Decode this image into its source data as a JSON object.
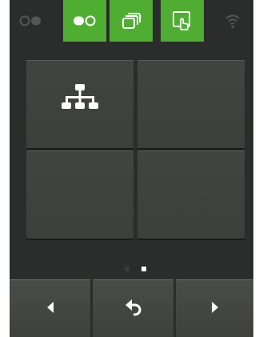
{
  "topbar": {
    "items": [
      {
        "name": "record-icon",
        "state": "disabled"
      },
      {
        "name": "tape-icon",
        "state": "active"
      },
      {
        "name": "stacked-windows-icon",
        "state": "active"
      },
      {
        "name": "touch-screen-icon",
        "state": "active"
      },
      {
        "name": "wifi-icon",
        "state": "disabled"
      }
    ]
  },
  "grid": {
    "tiles": [
      {
        "icon": "network-hierarchy-icon"
      },
      {
        "icon": ""
      },
      {
        "icon": ""
      },
      {
        "icon": ""
      }
    ]
  },
  "pagination": {
    "pages": 2,
    "current": 2
  },
  "bottombar": {
    "buttons": [
      {
        "icon": "arrow-left-icon"
      },
      {
        "icon": "undo-back-icon"
      },
      {
        "icon": "arrow-right-icon"
      }
    ]
  },
  "colors": {
    "background": "#2b2d2c",
    "accent_green": "#4fae32",
    "tile": "#424442",
    "icon_white": "#ffffff",
    "icon_disabled": "#555755"
  }
}
